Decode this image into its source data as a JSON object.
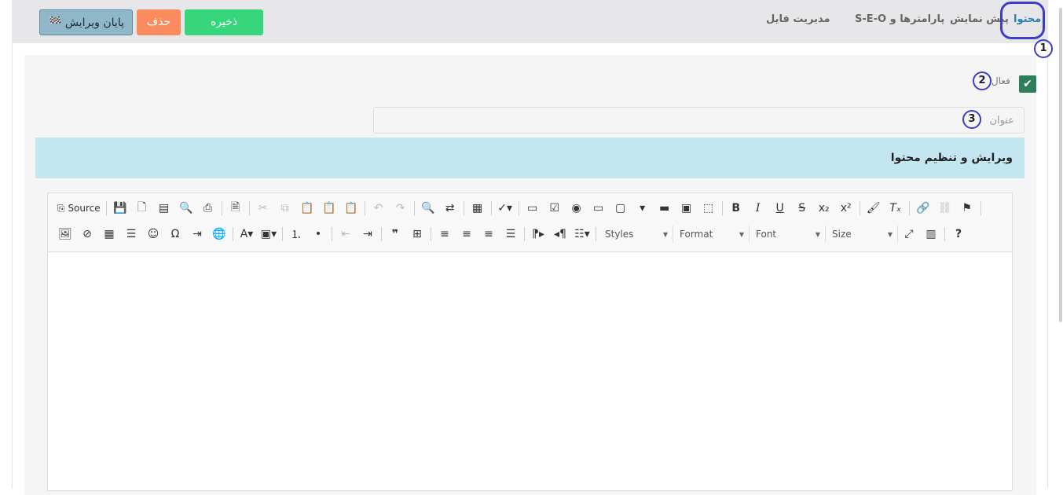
{
  "tabs": [
    {
      "label": "محتوا",
      "active": true
    },
    {
      "label": "پیش نمایش",
      "active": false
    },
    {
      "label": "پارامترها و S-E-O",
      "active": false
    },
    {
      "label": "مدیریت فایل",
      "active": false
    }
  ],
  "buttons": {
    "save": "ذخیره",
    "delete": "حذف",
    "finish": "پایان ویرایش",
    "finish_icon": "flag-icon"
  },
  "annotations": [
    "1",
    "2",
    "3"
  ],
  "form": {
    "active_label": "فعال",
    "active_checked": true,
    "title_placeholder": "عنوان",
    "title_value": ""
  },
  "section": {
    "heading": "ویرایش و تنظیم محتوا"
  },
  "editor": {
    "source_label": "Source",
    "combos": {
      "styles": "Styles",
      "format": "Format",
      "font": "Font",
      "size": "Size"
    }
  },
  "colors": {
    "active_tab": "#2b7fb8",
    "save": "#37d57c",
    "delete": "#f98b5e",
    "finish": "#8fb6c9",
    "section_bg": "#c4e6f0",
    "checkbox": "#2e7d5b",
    "annotation_ring": "#3d3dc9"
  }
}
